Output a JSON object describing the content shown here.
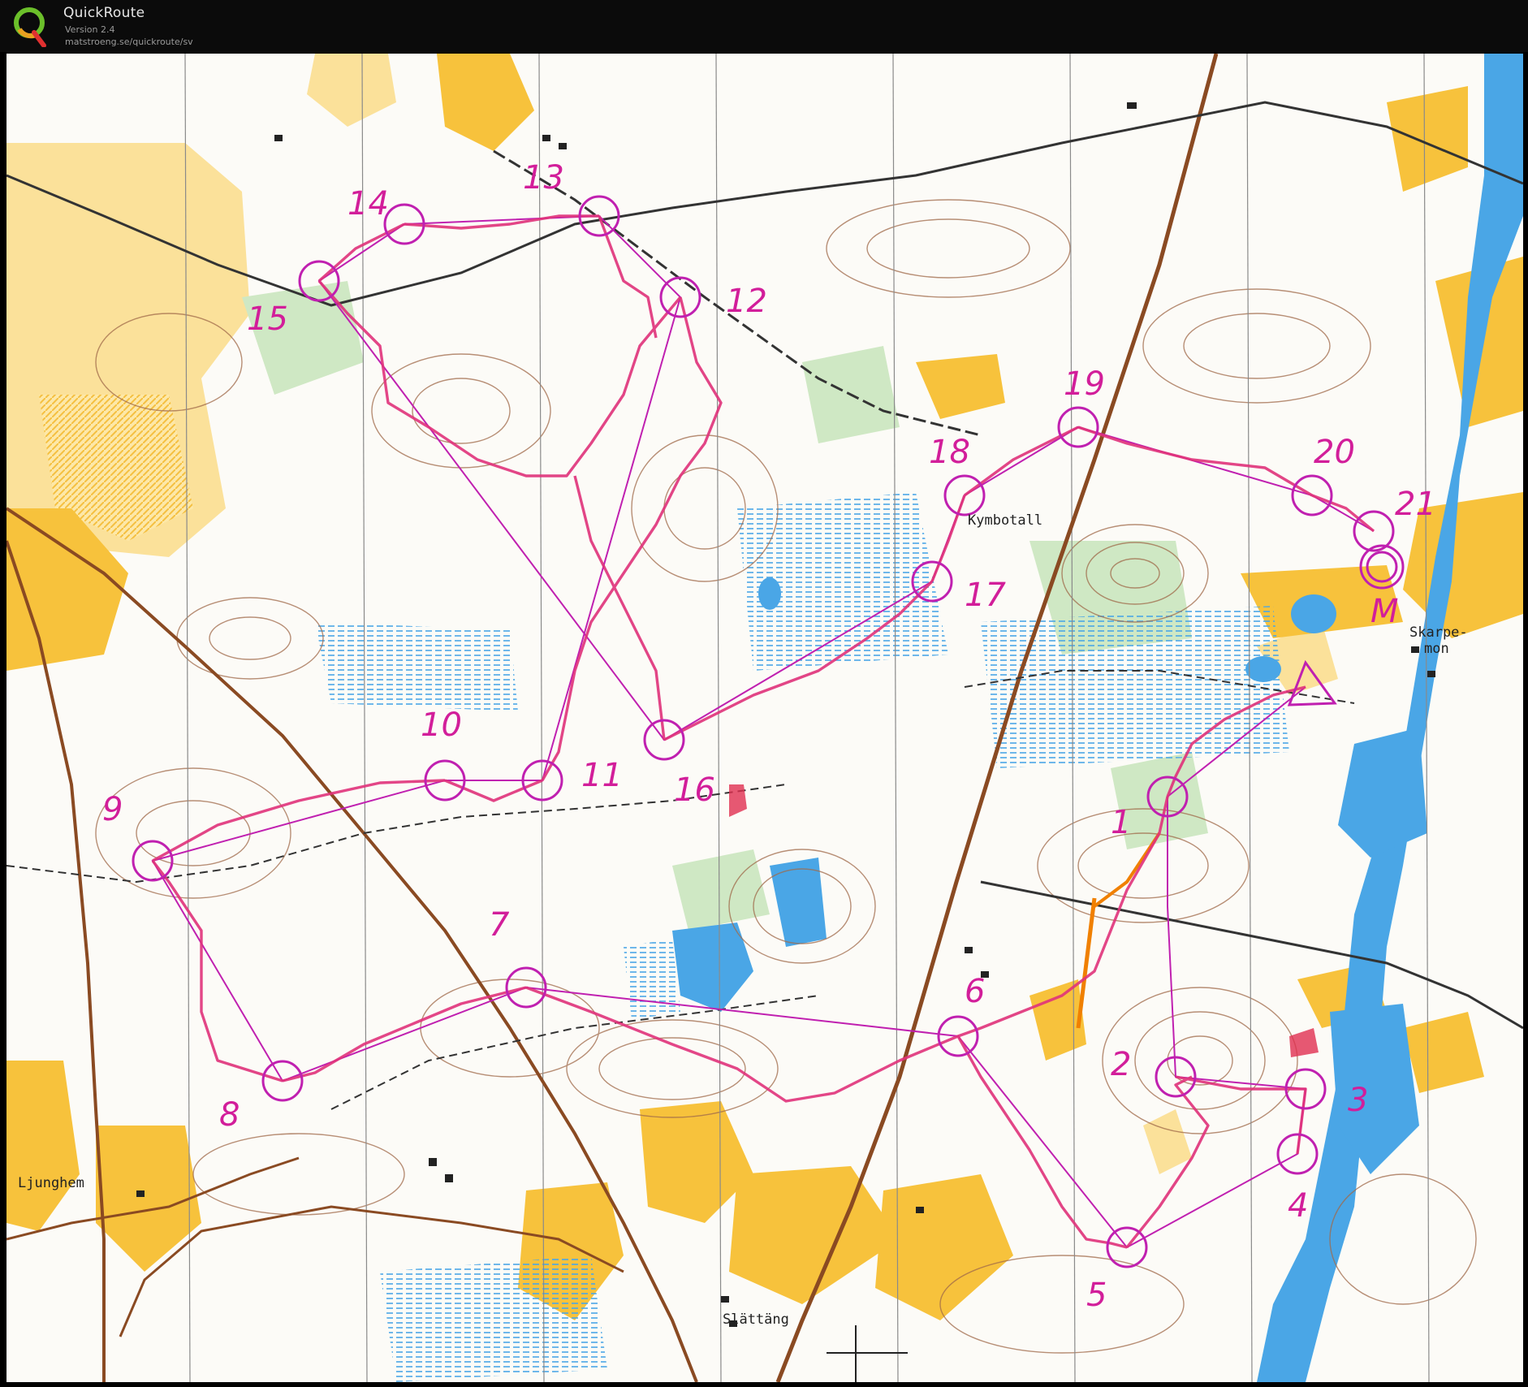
{
  "app": {
    "name": "QuickRoute",
    "version": "Version 2.4",
    "url": "matstroeng.se/quickroute/sv"
  },
  "map": {
    "colors": {
      "route": "#e0327a",
      "course": "#c020b0",
      "open_land": "#f7c23c",
      "rough_open": "#fbe19a",
      "water": "#4aa6e6",
      "contour": "#a06a4a",
      "road": "#8a4a22",
      "forest_green": "#cfe8c4"
    },
    "place_names": [
      "Kymbotall",
      "Skarpe-",
      "mon",
      "Ljunghem",
      "Slättäng"
    ],
    "start": {
      "symbol": "start-triangle"
    },
    "finish": {
      "label": "M"
    },
    "controls": [
      {
        "label": "1"
      },
      {
        "label": "2"
      },
      {
        "label": "3"
      },
      {
        "label": "4"
      },
      {
        "label": "5"
      },
      {
        "label": "6"
      },
      {
        "label": "7"
      },
      {
        "label": "8"
      },
      {
        "label": "9"
      },
      {
        "label": "10"
      },
      {
        "label": "11"
      },
      {
        "label": "12"
      },
      {
        "label": "13"
      },
      {
        "label": "14"
      },
      {
        "label": "15"
      },
      {
        "label": "16"
      },
      {
        "label": "17"
      },
      {
        "label": "18"
      },
      {
        "label": "19"
      },
      {
        "label": "20"
      },
      {
        "label": "21"
      }
    ]
  }
}
